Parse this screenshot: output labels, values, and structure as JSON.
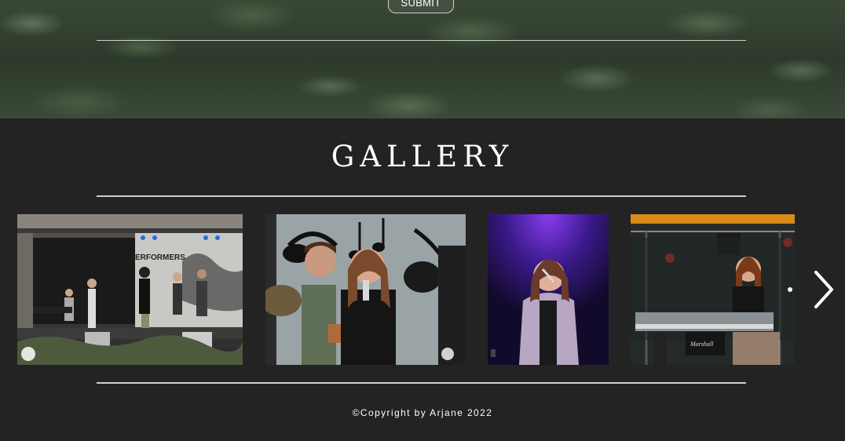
{
  "contact": {
    "submit_label": "SUBMIT"
  },
  "gallery": {
    "title": "GALLERY",
    "images": [
      {
        "name": "band-stage-photo",
        "banner_text": "ERFORMERS"
      },
      {
        "name": "singer-drummer-photo"
      },
      {
        "name": "singer-purple-light-photo"
      },
      {
        "name": "keyboard-singer-photo",
        "amp_text": "Marshall"
      }
    ],
    "next_icon": "chevron-right-icon"
  },
  "footer": {
    "copyright": "©Copyright by Arjane 2022"
  },
  "colors": {
    "background": "#232323",
    "text": "#ffffff",
    "rule": "#cfcfcf"
  }
}
